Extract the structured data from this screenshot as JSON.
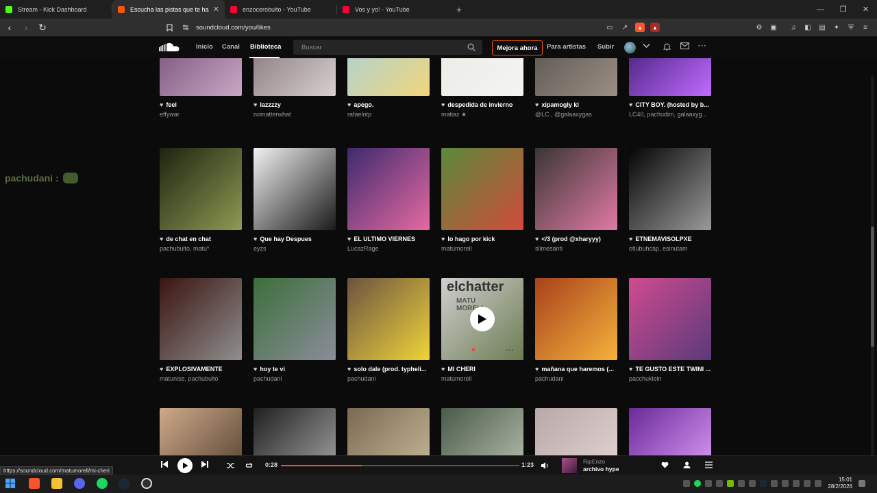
{
  "browser": {
    "tabs": [
      {
        "title": "Stream - Kick Dashboard",
        "color": "#53fc18"
      },
      {
        "title": "Escucha las pistas que te han gu",
        "color": "#ff5500"
      },
      {
        "title": "enzocerobulto - YouTube",
        "color": "#ff0033"
      },
      {
        "title": "Vos y yo! - YouTube",
        "color": "#ff0033"
      }
    ],
    "url": "soundcloud.com/you/likes"
  },
  "header": {
    "nav": [
      "Inicio",
      "Canal",
      "Biblioteca"
    ],
    "search_placeholder": "Buscar",
    "upgrade": "Mejora ahora",
    "for_artists": "Para artistas",
    "upload": "Subir"
  },
  "chat_overlay": {
    "user": "pachudani",
    "sep": ":"
  },
  "tracks": [
    {
      "title": "feel",
      "artist": "effywar",
      "art": [
        "#6b4670",
        "#c9a7c4"
      ]
    },
    {
      "title": "lazzzzy",
      "artist": "nomatterwhat",
      "art": [
        "#7a6a6d",
        "#d7cfcf"
      ]
    },
    {
      "title": "apego.",
      "artist": "rafaelotp",
      "art": [
        "#9fd1e8",
        "#f1d67b"
      ]
    },
    {
      "title": "despedida de invierno",
      "artist": "matiaz ★",
      "art": [
        "#e9e9e6",
        "#f4f4f0"
      ]
    },
    {
      "title": "xipamogly kl",
      "artist": "@LC , @galaaxygas",
      "art": [
        "#4f4a45",
        "#9b8f86"
      ]
    },
    {
      "title": "CITY BOY. (hosted by b...",
      "artist": "LC40, pachudim, galaaxyg...",
      "art": [
        "#2d1260",
        "#c06bff"
      ]
    },
    {
      "title": "de chat en chat",
      "artist": "pachubulto, matu*",
      "art": [
        "#1c2410",
        "#8f9a52"
      ]
    },
    {
      "title": "Que hay Despues",
      "artist": "eyzs",
      "art": [
        "#f2f2f2",
        "#1a1a1a"
      ]
    },
    {
      "title": "EL ULTIMO VIERNES",
      "artist": "LucazRage",
      "art": [
        "#3e2a6f",
        "#e56aa0"
      ]
    },
    {
      "title": "lo hago por kick",
      "artist": "matumorell",
      "art": [
        "#5a8a3a",
        "#d14b3b"
      ]
    },
    {
      "title": "</3 (prod @xharyyy)",
      "artist": "slimesanti",
      "art": [
        "#3b3634",
        "#e07aa4"
      ]
    },
    {
      "title": "ETNEMAVISOLPXE",
      "artist": "otlubuhcap, esinutam",
      "art": [
        "#050505",
        "#9a9a9a"
      ]
    },
    {
      "title": "EXPLOSIVAMENTE",
      "artist": "matunise, pachubulto",
      "art": [
        "#3a1410",
        "#8f8f8f"
      ]
    },
    {
      "title": "hoy te vi",
      "artist": "pachudani",
      "art": [
        "#3b6f3a",
        "#8c8c9a"
      ]
    },
    {
      "title": "solo dale (prod. typheli...",
      "artist": "pachudani",
      "art": [
        "#6b5340",
        "#f0d43a"
      ]
    },
    {
      "title": "MI CHERI",
      "artist": "matumorell",
      "art": [
        "#cfcfcf",
        "#6d7c52"
      ]
    },
    {
      "title": "mañana que haremos (...",
      "artist": "pachudani",
      "art": [
        "#a8421a",
        "#f5b23e"
      ]
    },
    {
      "title": "TE GUSTO ESTE TWINI ...",
      "artist": "pacchuklein",
      "art": [
        "#d04b8f",
        "#5a3a7a"
      ]
    },
    {
      "title": "",
      "artist": "",
      "art": [
        "#cfa98a",
        "#4a3a2a"
      ]
    },
    {
      "title": "",
      "artist": "",
      "art": [
        "#202020",
        "#b0b0b0"
      ]
    },
    {
      "title": "",
      "artist": "",
      "art": [
        "#7a6a52",
        "#d0c0a0"
      ]
    },
    {
      "title": "",
      "artist": "",
      "art": [
        "#4a5a4a",
        "#c0c8b8"
      ]
    },
    {
      "title": "",
      "artist": "",
      "art": [
        "#b8a8a8",
        "#e8d8d8"
      ]
    },
    {
      "title": "",
      "artist": "",
      "art": [
        "#6a2a9a",
        "#e8a8ff"
      ]
    }
  ],
  "mi_cheri_overlay": {
    "text": "elchatter",
    "sub": "MATU MORELL"
  },
  "player": {
    "elapsed": "0:28",
    "duration": "1:23",
    "progress": 0.34,
    "artist": "RipEnzo",
    "title": "archivo hype"
  },
  "status_url": "https://soundcloud.com/matumorell/mi-cheri",
  "clock": {
    "time": "15:01",
    "date": "28/2/2026"
  }
}
